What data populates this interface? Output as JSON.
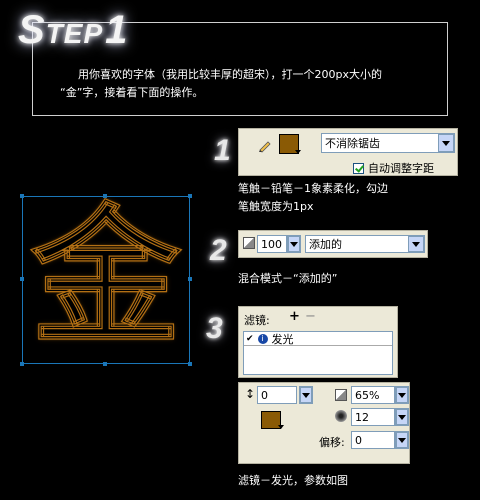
{
  "header": {
    "title_s": "S",
    "title_tep": "TEP",
    "title_num": "1",
    "intro_line1": "用你喜欢的字体（我用比较丰厚的超宋），打一个200px大小的",
    "intro_line2": "“金”字，接着看下面的操作。"
  },
  "artwork": {
    "character": "金",
    "stroke_color": "#b26f14",
    "frame_color": "#1a76b8"
  },
  "step1": {
    "number": "1",
    "antialias_option": "不消除锯齿",
    "auto_kern_label": "自动调整字距",
    "auto_kern_checked": true,
    "swatch_color": "#8a5a05",
    "caption_line1": "笔触－铅笔－1象素柔化，勾边",
    "caption_line2": "笔触宽度为1px"
  },
  "step2": {
    "number": "2",
    "opacity_value": "100",
    "blend_mode": "添加的",
    "caption": "混合模式－“添加的”"
  },
  "step3": {
    "number": "3",
    "filters_label": "滤镜:",
    "add_icon": "+",
    "remove_icon": "−",
    "filter_item": "发光",
    "spread_value": "0",
    "opacity_value": "65%",
    "softness_value": "12",
    "offset_label": "偏移:",
    "offset_value": "0",
    "glow_color": "#8a5a05",
    "caption": "滤镜－发光，参数如图"
  }
}
